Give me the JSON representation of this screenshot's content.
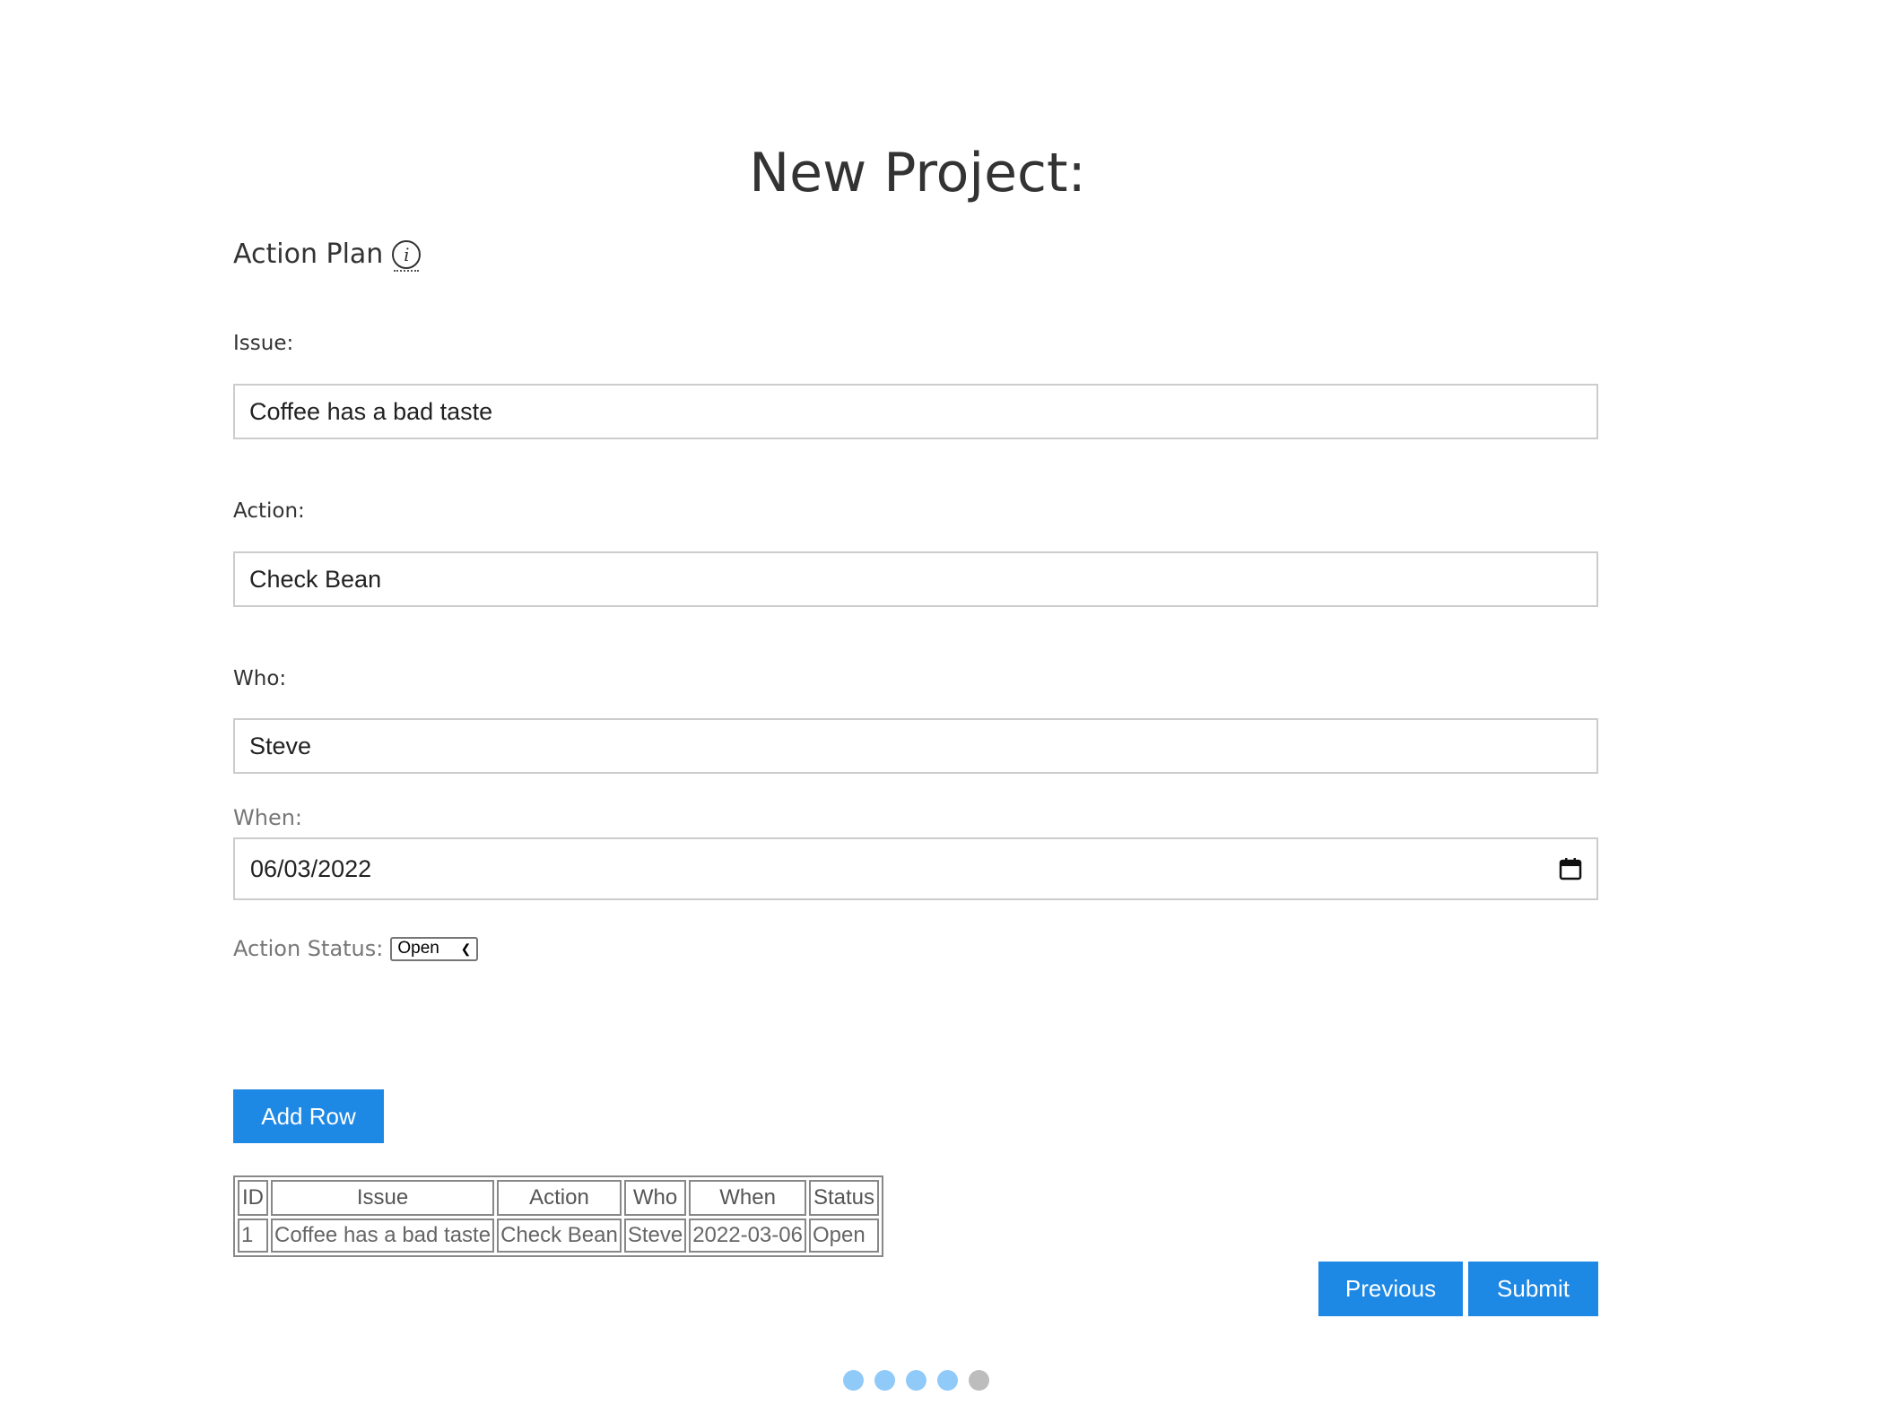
{
  "page": {
    "title": "New Project:",
    "section_title": "Action Plan",
    "info_glyph": "i"
  },
  "form": {
    "issue_label": "Issue:",
    "issue_value": "Coffee has a bad taste",
    "action_label": "Action:",
    "action_value": "Check Bean",
    "who_label": "Who:",
    "who_value": "Steve",
    "when_label": "When:",
    "when_value": "06/03/2022",
    "status_label": "Action Status:",
    "status_selected": "Open"
  },
  "buttons": {
    "add_row": "Add Row",
    "previous": "Previous",
    "submit": "Submit"
  },
  "table": {
    "headers": [
      "ID",
      "Issue",
      "Action",
      "Who",
      "When",
      "Status"
    ],
    "rows": [
      [
        "1",
        "Coffee has a bad taste",
        "Check Bean",
        "Steve",
        "2022-03-06",
        "Open"
      ]
    ]
  },
  "progress": {
    "steps_total": 5,
    "current_step": 5
  },
  "colors": {
    "primary": "#1e88e5",
    "dot_active": "#90caf9",
    "dot_inactive": "#bdbdbd"
  }
}
